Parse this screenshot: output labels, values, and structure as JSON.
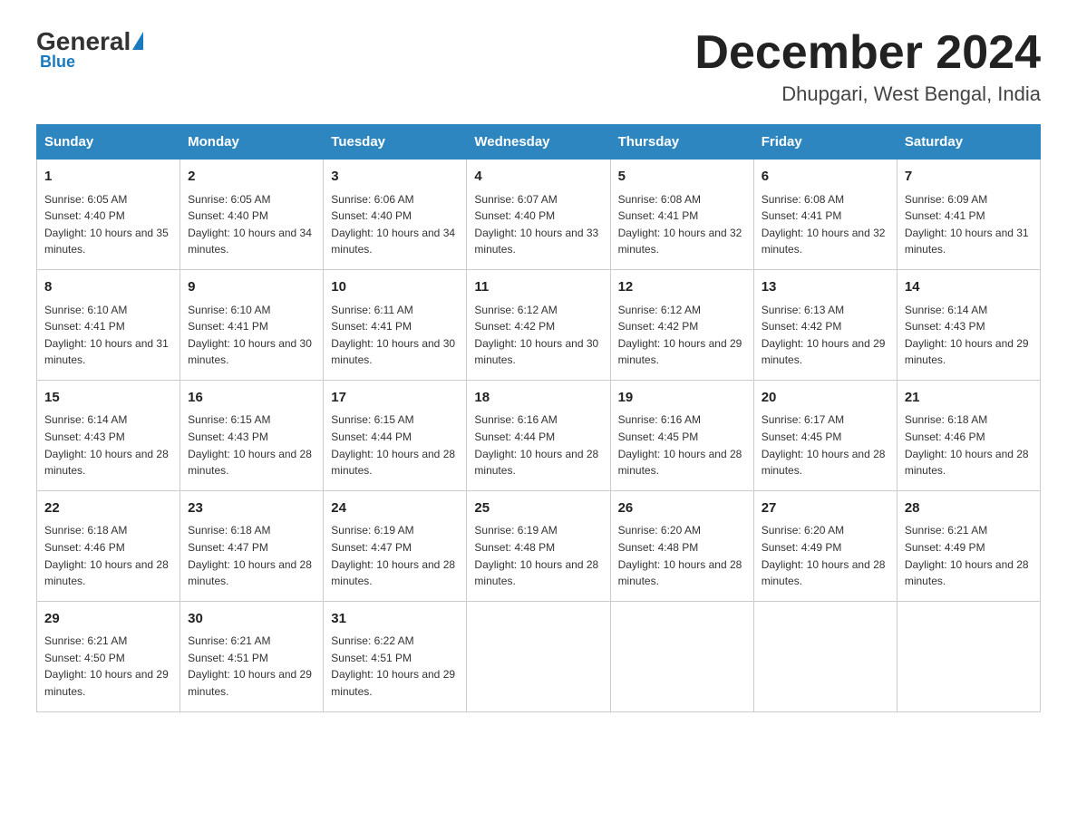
{
  "logo": {
    "general": "General",
    "blue": "Blue"
  },
  "title": "December 2024",
  "subtitle": "Dhupgari, West Bengal, India",
  "header_days": [
    "Sunday",
    "Monday",
    "Tuesday",
    "Wednesday",
    "Thursday",
    "Friday",
    "Saturday"
  ],
  "weeks": [
    [
      {
        "day": "1",
        "sunrise": "6:05 AM",
        "sunset": "4:40 PM",
        "daylight": "10 hours and 35 minutes."
      },
      {
        "day": "2",
        "sunrise": "6:05 AM",
        "sunset": "4:40 PM",
        "daylight": "10 hours and 34 minutes."
      },
      {
        "day": "3",
        "sunrise": "6:06 AM",
        "sunset": "4:40 PM",
        "daylight": "10 hours and 34 minutes."
      },
      {
        "day": "4",
        "sunrise": "6:07 AM",
        "sunset": "4:40 PM",
        "daylight": "10 hours and 33 minutes."
      },
      {
        "day": "5",
        "sunrise": "6:08 AM",
        "sunset": "4:41 PM",
        "daylight": "10 hours and 32 minutes."
      },
      {
        "day": "6",
        "sunrise": "6:08 AM",
        "sunset": "4:41 PM",
        "daylight": "10 hours and 32 minutes."
      },
      {
        "day": "7",
        "sunrise": "6:09 AM",
        "sunset": "4:41 PM",
        "daylight": "10 hours and 31 minutes."
      }
    ],
    [
      {
        "day": "8",
        "sunrise": "6:10 AM",
        "sunset": "4:41 PM",
        "daylight": "10 hours and 31 minutes."
      },
      {
        "day": "9",
        "sunrise": "6:10 AM",
        "sunset": "4:41 PM",
        "daylight": "10 hours and 30 minutes."
      },
      {
        "day": "10",
        "sunrise": "6:11 AM",
        "sunset": "4:41 PM",
        "daylight": "10 hours and 30 minutes."
      },
      {
        "day": "11",
        "sunrise": "6:12 AM",
        "sunset": "4:42 PM",
        "daylight": "10 hours and 30 minutes."
      },
      {
        "day": "12",
        "sunrise": "6:12 AM",
        "sunset": "4:42 PM",
        "daylight": "10 hours and 29 minutes."
      },
      {
        "day": "13",
        "sunrise": "6:13 AM",
        "sunset": "4:42 PM",
        "daylight": "10 hours and 29 minutes."
      },
      {
        "day": "14",
        "sunrise": "6:14 AM",
        "sunset": "4:43 PM",
        "daylight": "10 hours and 29 minutes."
      }
    ],
    [
      {
        "day": "15",
        "sunrise": "6:14 AM",
        "sunset": "4:43 PM",
        "daylight": "10 hours and 28 minutes."
      },
      {
        "day": "16",
        "sunrise": "6:15 AM",
        "sunset": "4:43 PM",
        "daylight": "10 hours and 28 minutes."
      },
      {
        "day": "17",
        "sunrise": "6:15 AM",
        "sunset": "4:44 PM",
        "daylight": "10 hours and 28 minutes."
      },
      {
        "day": "18",
        "sunrise": "6:16 AM",
        "sunset": "4:44 PM",
        "daylight": "10 hours and 28 minutes."
      },
      {
        "day": "19",
        "sunrise": "6:16 AM",
        "sunset": "4:45 PM",
        "daylight": "10 hours and 28 minutes."
      },
      {
        "day": "20",
        "sunrise": "6:17 AM",
        "sunset": "4:45 PM",
        "daylight": "10 hours and 28 minutes."
      },
      {
        "day": "21",
        "sunrise": "6:18 AM",
        "sunset": "4:46 PM",
        "daylight": "10 hours and 28 minutes."
      }
    ],
    [
      {
        "day": "22",
        "sunrise": "6:18 AM",
        "sunset": "4:46 PM",
        "daylight": "10 hours and 28 minutes."
      },
      {
        "day": "23",
        "sunrise": "6:18 AM",
        "sunset": "4:47 PM",
        "daylight": "10 hours and 28 minutes."
      },
      {
        "day": "24",
        "sunrise": "6:19 AM",
        "sunset": "4:47 PM",
        "daylight": "10 hours and 28 minutes."
      },
      {
        "day": "25",
        "sunrise": "6:19 AM",
        "sunset": "4:48 PM",
        "daylight": "10 hours and 28 minutes."
      },
      {
        "day": "26",
        "sunrise": "6:20 AM",
        "sunset": "4:48 PM",
        "daylight": "10 hours and 28 minutes."
      },
      {
        "day": "27",
        "sunrise": "6:20 AM",
        "sunset": "4:49 PM",
        "daylight": "10 hours and 28 minutes."
      },
      {
        "day": "28",
        "sunrise": "6:21 AM",
        "sunset": "4:49 PM",
        "daylight": "10 hours and 28 minutes."
      }
    ],
    [
      {
        "day": "29",
        "sunrise": "6:21 AM",
        "sunset": "4:50 PM",
        "daylight": "10 hours and 29 minutes."
      },
      {
        "day": "30",
        "sunrise": "6:21 AM",
        "sunset": "4:51 PM",
        "daylight": "10 hours and 29 minutes."
      },
      {
        "day": "31",
        "sunrise": "6:22 AM",
        "sunset": "4:51 PM",
        "daylight": "10 hours and 29 minutes."
      },
      null,
      null,
      null,
      null
    ]
  ]
}
